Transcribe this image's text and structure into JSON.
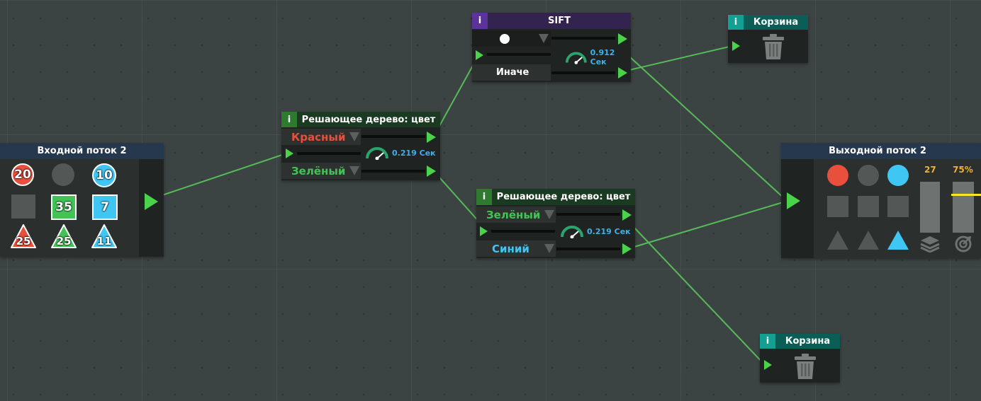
{
  "colors": {
    "red": "#e84f3d",
    "green": "#43c356",
    "blue": "#3fc6f3",
    "gray": "#535756",
    "wire": "#5ccf5c",
    "port": "#4ad34a",
    "header_blue": "#26384e",
    "header_green": "#1b3a22",
    "header_purple": "#33244f",
    "header_teal": "#0a5e55",
    "info_green": "#2f7a31",
    "info_purple": "#5c339a",
    "info_teal": "#12a092",
    "speed_blue": "#3fb0ea",
    "counter_orange": "#f1b03a",
    "threshold_yellow": "#f6ea1f"
  },
  "input_stream": {
    "title": "Входной поток 2",
    "items": [
      {
        "shape": "circle",
        "color": "red",
        "count": "20"
      },
      {
        "shape": "circle",
        "color": "gray",
        "count": ""
      },
      {
        "shape": "circle",
        "color": "blue",
        "count": "10"
      },
      {
        "shape": "square",
        "color": "gray",
        "count": ""
      },
      {
        "shape": "square",
        "color": "green",
        "count": "35"
      },
      {
        "shape": "square",
        "color": "blue",
        "count": "7"
      },
      {
        "shape": "triangle",
        "color": "red",
        "count": "25"
      },
      {
        "shape": "triangle",
        "color": "green",
        "count": "25"
      },
      {
        "shape": "triangle",
        "color": "blue",
        "count": "11"
      }
    ]
  },
  "tree_top": {
    "info": "i",
    "title": "Решающее дерево: цвет",
    "option_top": "Красный",
    "option_bottom": "Зелёный",
    "speed": "0.219 Сек"
  },
  "sift": {
    "info": "i",
    "title": "SIFT",
    "option_top_icon": "white-circle-icon",
    "option_bottom": "Иначе",
    "speed": "0.912 Сек"
  },
  "tree_bottom": {
    "info": "i",
    "title": "Решающее дерево: цвет",
    "option_top": "Зелёный",
    "option_bottom": "Синий",
    "speed": "0.219 Сек"
  },
  "trash_top": {
    "info": "i",
    "title": "Корзина",
    "icon": "trash-icon"
  },
  "trash_bottom": {
    "info": "i",
    "title": "Корзина",
    "icon": "trash-icon"
  },
  "output_stream": {
    "title": "Выходной поток 2",
    "items": [
      {
        "shape": "circle",
        "color": "red"
      },
      {
        "shape": "circle",
        "color": "gray"
      },
      {
        "shape": "circle",
        "color": "blue"
      },
      {
        "shape": "square",
        "color": "gray"
      },
      {
        "shape": "square",
        "color": "gray"
      },
      {
        "shape": "square",
        "color": "gray"
      },
      {
        "shape": "triangle",
        "color": "gray"
      },
      {
        "shape": "triangle",
        "color": "gray"
      },
      {
        "shape": "triangle",
        "color": "blue"
      }
    ],
    "count": "27",
    "accuracy": "75%",
    "count_meter_fraction": 1.0,
    "accuracy_meter_fraction": 1.0,
    "accuracy_target_fraction": 0.75
  }
}
